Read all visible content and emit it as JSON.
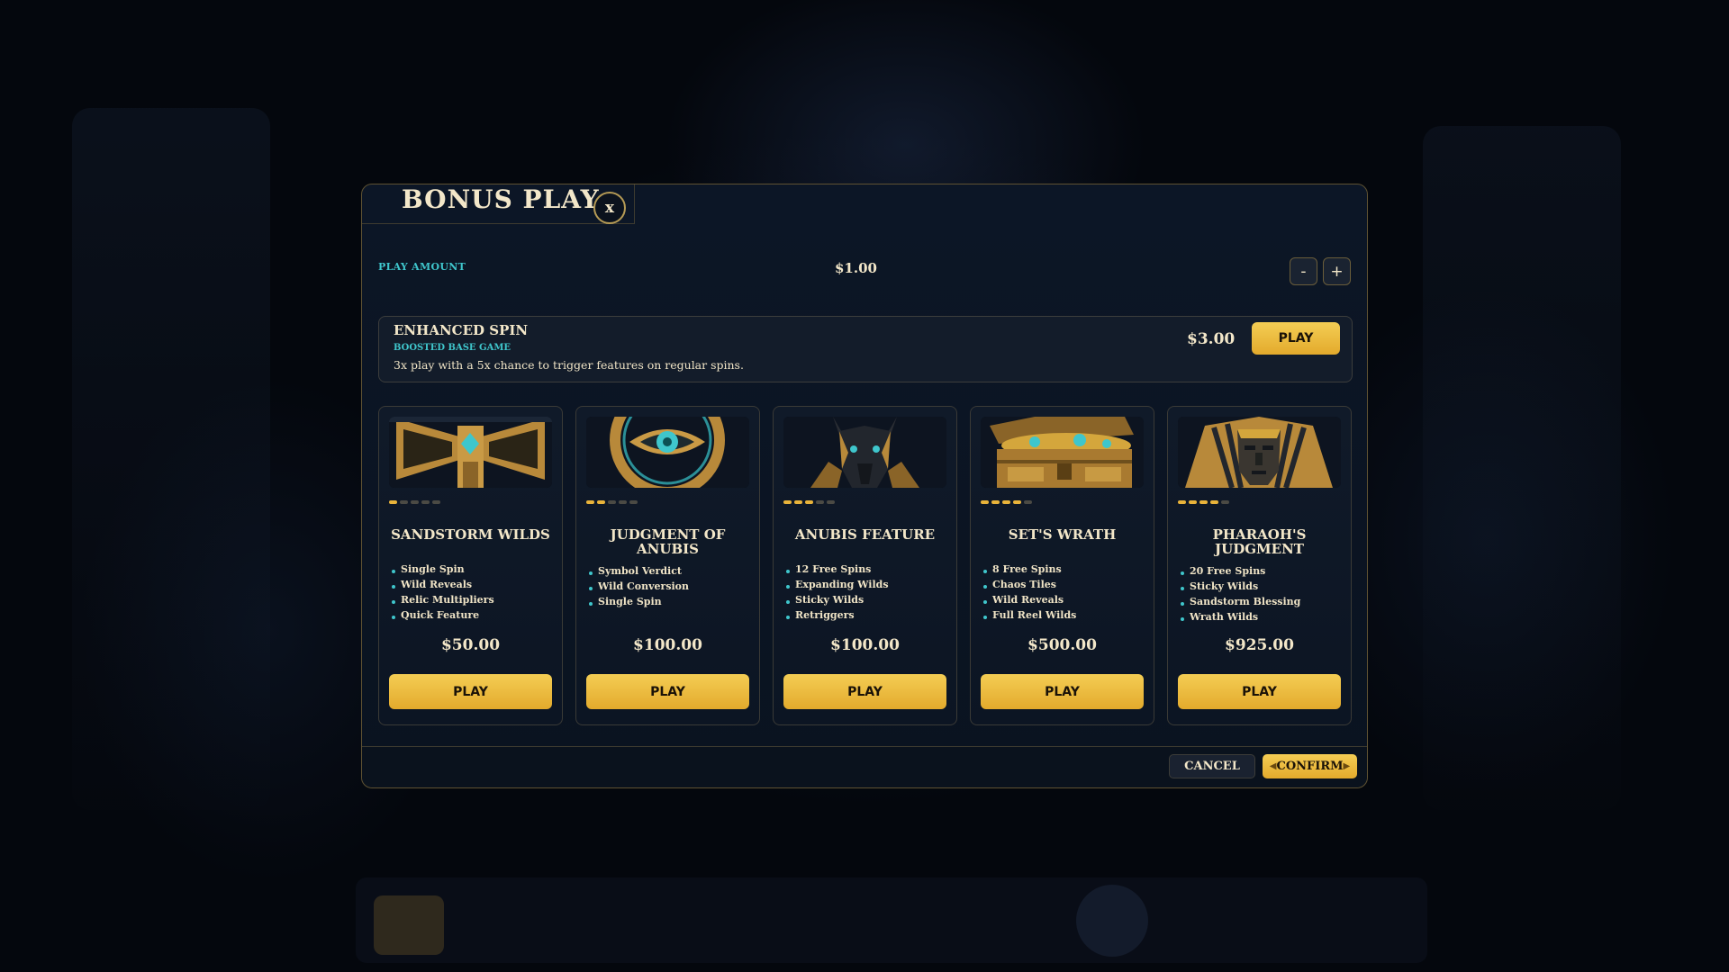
{
  "modal": {
    "title": "BONUS PLAY",
    "close_label": "x"
  },
  "play_amount": {
    "label": "PLAY AMOUNT",
    "value": "$1.00",
    "minus_label": "-",
    "plus_label": "+"
  },
  "enhanced_spin": {
    "title": "ENHANCED SPIN",
    "subtitle": "BOOSTED BASE GAME",
    "description": "3x play with a 5x chance to trigger features on regular spins.",
    "price": "$3.00",
    "play_label": "PLAY"
  },
  "cards": [
    {
      "name": "SANDSTORM WILDS",
      "image": "ankh-relic-icon",
      "level": 1,
      "features": [
        "Single Spin",
        "Wild Reveals",
        "Relic Multipliers",
        "Quick Feature"
      ],
      "price": "$50.00",
      "play_label": "PLAY"
    },
    {
      "name": "JUDGMENT OF ANUBIS",
      "image": "eye-of-horus-icon",
      "level": 2,
      "features": [
        "Symbol Verdict",
        "Wild Conversion",
        "Single Spin"
      ],
      "price": "$100.00",
      "play_label": "PLAY"
    },
    {
      "name": "ANUBIS FEATURE",
      "image": "anubis-head-icon",
      "level": 3,
      "features": [
        "12 Free Spins",
        "Expanding Wilds",
        "Sticky Wilds",
        "Retriggers"
      ],
      "price": "$100.00",
      "play_label": "PLAY"
    },
    {
      "name": "SET'S WRATH",
      "image": "treasure-chest-icon",
      "level": 4,
      "features": [
        "8 Free Spins",
        "Chaos Tiles",
        "Wild Reveals",
        "Full Reel Wilds"
      ],
      "price": "$500.00",
      "play_label": "PLAY"
    },
    {
      "name": "PHARAOH'S JUDGMENT",
      "image": "pharaoh-mask-icon",
      "level": 4,
      "features": [
        "20 Free Spins",
        "Sticky Wilds",
        "Sandstorm Blessing",
        "Wrath Wilds"
      ],
      "price": "$925.00",
      "play_label": "PLAY"
    }
  ],
  "level_max": 5,
  "footer": {
    "cancel_label": "CANCEL",
    "confirm_label": "CONFIRM"
  },
  "colors": {
    "accent_gold": "#e9b33a",
    "accent_teal": "#3fc6cc",
    "text_cream": "#f3e7c9",
    "panel_bg": "#0c1626"
  }
}
